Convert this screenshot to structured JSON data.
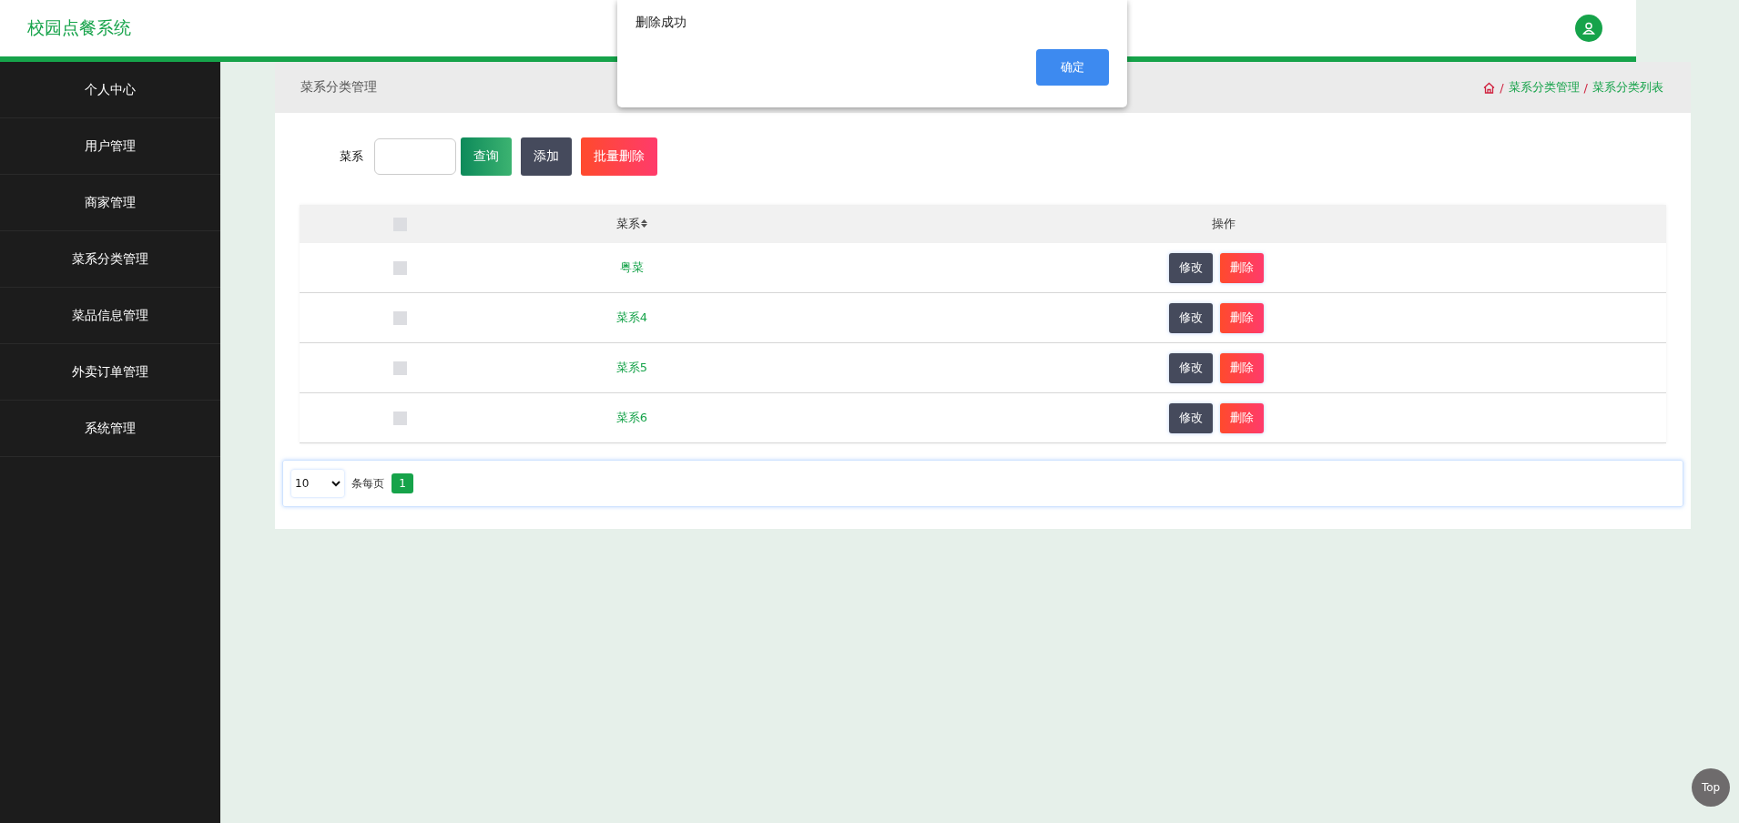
{
  "header": {
    "title": "校园点餐系统"
  },
  "sidebar": {
    "items": [
      {
        "label": "个人中心"
      },
      {
        "label": "用户管理"
      },
      {
        "label": "商家管理"
      },
      {
        "label": "菜系分类管理"
      },
      {
        "label": "菜品信息管理"
      },
      {
        "label": "外卖订单管理"
      },
      {
        "label": "系统管理"
      }
    ]
  },
  "page_title": "菜系分类管理",
  "breadcrumb": [
    {
      "separator": "/",
      "label": "菜系分类管理"
    },
    {
      "separator": "/",
      "label": "菜系分类列表"
    }
  ],
  "search": {
    "label": "菜系",
    "buttons": [
      {
        "label": "查询",
        "kind": "query"
      },
      {
        "label": "添加",
        "kind": "add"
      },
      {
        "label": "批量删除",
        "kind": "delete"
      }
    ]
  },
  "table": {
    "columns": [
      "菜系",
      "操作"
    ],
    "header_checked": false,
    "rows": [
      {
        "name": "粤菜",
        "checked": false,
        "actions": [
          "修改",
          "删除"
        ]
      },
      {
        "name": "菜系4",
        "checked": false,
        "actions": [
          "修改",
          "删除"
        ]
      },
      {
        "name": "菜系5",
        "checked": false,
        "actions": [
          "修改",
          "删除"
        ]
      },
      {
        "name": "菜系6",
        "checked": false,
        "actions": [
          "修改",
          "删除"
        ]
      }
    ]
  },
  "pagination": {
    "page_size": "10",
    "page_size_label": "条每页",
    "pages": [
      {
        "label": "1",
        "selected": true
      }
    ]
  },
  "dialog": {
    "message": "删除成功",
    "button": "确定"
  },
  "back_to_top": "Top"
}
